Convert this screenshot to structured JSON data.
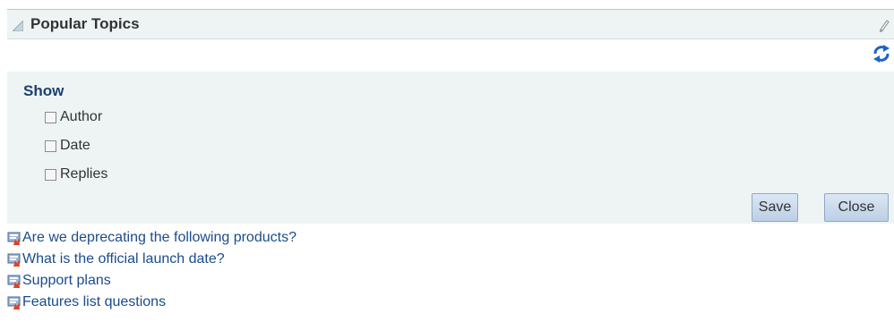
{
  "header": {
    "title": "Popular Topics",
    "collapse_icon": "collapse-triangle-icon",
    "edit_icon": "pencil-icon",
    "refresh_icon": "refresh-icon"
  },
  "options": {
    "show_label": "Show",
    "checkboxes": [
      {
        "label": "Author",
        "checked": false
      },
      {
        "label": "Date",
        "checked": false
      },
      {
        "label": "Replies",
        "checked": false
      }
    ],
    "save_label": "Save",
    "close_label": "Close"
  },
  "topics": [
    {
      "title": "Are we deprecating the following products?"
    },
    {
      "title": "What is the official launch date?"
    },
    {
      "title": "Support plans"
    },
    {
      "title": "Features list questions"
    }
  ],
  "colors": {
    "panel_bg": "#eef4f4",
    "link": "#1a4c8c",
    "heading": "#1c3f6e",
    "refresh": "#1f63c4"
  }
}
